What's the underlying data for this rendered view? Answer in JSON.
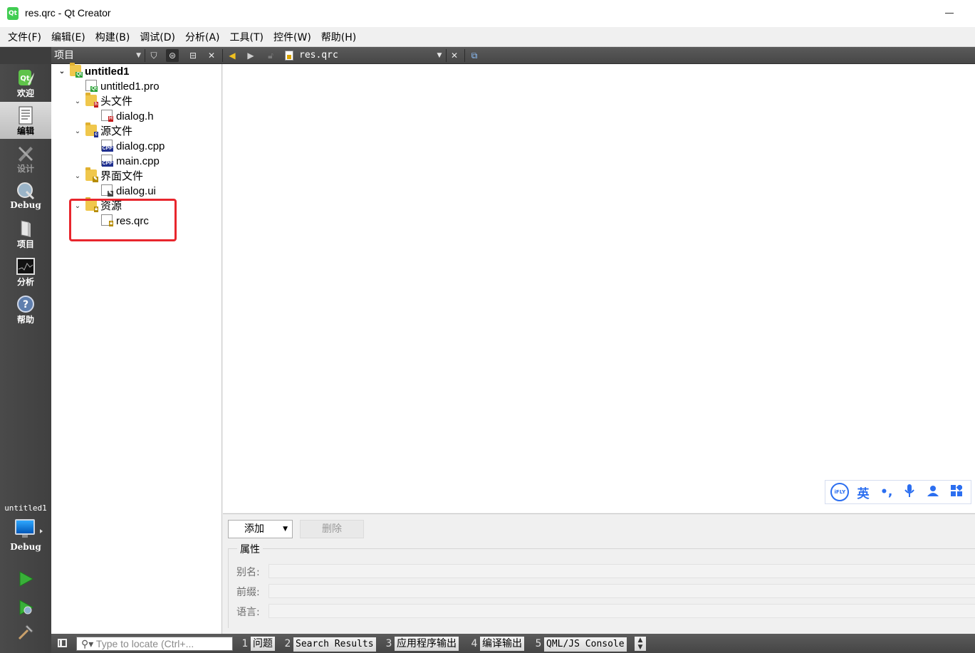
{
  "window": {
    "title": "res.qrc - Qt Creator",
    "app_icon": "qt-creator-icon"
  },
  "menubar": [
    "文件(F)",
    "编辑(E)",
    "构建(B)",
    "调试(D)",
    "分析(A)",
    "工具(T)",
    "控件(W)",
    "帮助(H)"
  ],
  "modebar": {
    "modes": [
      {
        "label": "欢迎",
        "icon": "qt-welcome-icon",
        "state": "normal"
      },
      {
        "label": "编辑",
        "icon": "edit-document-icon",
        "state": "active"
      },
      {
        "label": "设计",
        "icon": "design-tools-icon",
        "state": "disabled"
      },
      {
        "label": "Debug",
        "icon": "debug-bug-icon",
        "state": "normal"
      },
      {
        "label": "项目",
        "icon": "project-wrench-icon",
        "state": "normal"
      },
      {
        "label": "分析",
        "icon": "analyze-oscilloscope-icon",
        "state": "normal"
      },
      {
        "label": "帮助",
        "icon": "help-question-icon",
        "state": "normal"
      }
    ],
    "kit": {
      "project": "untitled1",
      "config": "Debug",
      "icon": "desktop-kit-icon"
    },
    "actions": [
      "run-icon",
      "debug-run-icon",
      "build-hammer-icon"
    ]
  },
  "navpane": {
    "view_selector": "项目",
    "tools": [
      "filter-icon",
      "sync-link-icon",
      "split-icon",
      "close-icon"
    ]
  },
  "editor_toolbar": {
    "file": "res.qrc",
    "tools": [
      "back-arrow-icon",
      "forward-arrow-icon",
      "lock-icon",
      "close-document-icon",
      "split-editor-icon"
    ]
  },
  "tree": {
    "root": "untitled1",
    "pro_file": "untitled1.pro",
    "headers": {
      "label": "头文件",
      "files": [
        "dialog.h"
      ]
    },
    "sources": {
      "label": "源文件",
      "files": [
        "dialog.cpp",
        "main.cpp"
      ]
    },
    "forms": {
      "label": "界面文件",
      "files": [
        "dialog.ui"
      ]
    },
    "resources": {
      "label": "资源",
      "files": [
        "res.qrc"
      ]
    }
  },
  "ime_toolbar": {
    "buttons": [
      "iflytek-logo",
      "英",
      "punctuation-icon",
      "microphone-icon",
      "user-icon",
      "apps-grid-icon"
    ],
    "logo_text": "iFLY",
    "lang": "英"
  },
  "resource_editor": {
    "add_button": "添加",
    "remove_button": "删除",
    "properties": {
      "title": "属性",
      "alias_label": "别名:",
      "prefix_label": "前缀:",
      "language_label": "语言:",
      "alias_value": "",
      "prefix_value": "",
      "language_value": ""
    }
  },
  "statusbar": {
    "locator_placeholder": "Type to locate (Ctrl+...",
    "tabs": [
      {
        "num": "1",
        "label": "问题"
      },
      {
        "num": "2",
        "label": "Search Results"
      },
      {
        "num": "3",
        "label": "应用程序输出"
      },
      {
        "num": "4",
        "label": "编译输出"
      },
      {
        "num": "5",
        "label": "QML/JS Console"
      }
    ]
  },
  "colors": {
    "highlight_box": "#e8262d",
    "mode_bar": "#444444",
    "ime_blue": "#2b6ef0"
  }
}
